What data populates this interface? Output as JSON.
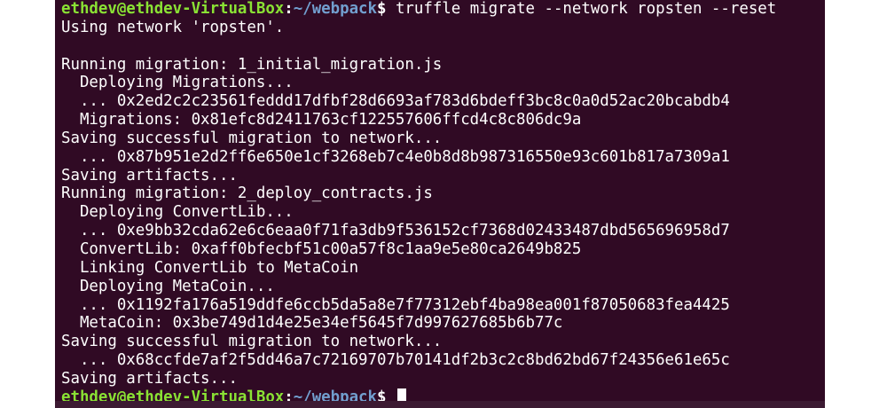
{
  "colors": {
    "background": "#300a24",
    "text": "#ffffff",
    "prompt_user": "#8ae234",
    "prompt_path": "#729fcf"
  },
  "prompt": {
    "user_host": "ethdev@ethdev-VirtualBox",
    "separator": ":",
    "path": "~/webpack",
    "symbol": "$"
  },
  "command": " truffle migrate --network ropsten --reset",
  "output": [
    "Using network 'ropsten'.",
    "",
    "Running migration: 1_initial_migration.js",
    "  Deploying Migrations...",
    "  ... 0x2ed2c2c23561feddd17dfbf28d6693af783d6bdeff3bc8c0a0d52ac20bcabdb4",
    "  Migrations: 0x81efc8d2411763cf122557606ffcd4c8c806dc9a",
    "Saving successful migration to network...",
    "  ... 0x87b951e2d2ff6e650e1cf3268eb7c4e0b8d8b987316550e93c601b817a7309a1",
    "Saving artifacts...",
    "Running migration: 2_deploy_contracts.js",
    "  Deploying ConvertLib...",
    "  ... 0xe9bb32cda62e6c6eaa0f71fa3db9f536152cf7368d02433487dbd565696958d7",
    "  ConvertLib: 0xaff0bfecbf51c00a57f8c1aa9e5e80ca2649b825",
    "  Linking ConvertLib to MetaCoin",
    "  Deploying MetaCoin...",
    "  ... 0x1192fa176a519ddfe6ccb5da5a8e7f77312ebf4ba98ea001f87050683fea4425",
    "  MetaCoin: 0x3be749d1d4e25e34ef5645f7d997627685b6b77c",
    "Saving successful migration to network...",
    "  ... 0x68ccfde7af2f5dd46a7c72169707b70141df2b3c2c8bd62bd67f24356e61e65c",
    "Saving artifacts..."
  ]
}
